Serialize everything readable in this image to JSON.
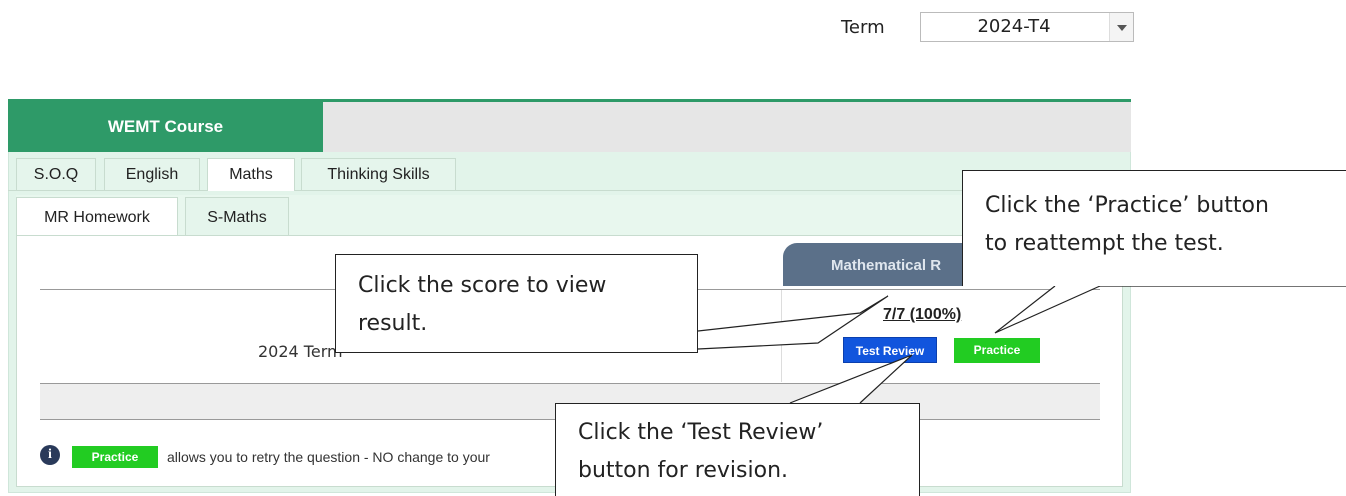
{
  "term": {
    "label": "Term",
    "value": "2024-T4"
  },
  "course": {
    "title": "WEMT Course"
  },
  "subject_tabs": [
    {
      "label": "S.O.Q"
    },
    {
      "label": "English"
    },
    {
      "label": "Maths"
    },
    {
      "label": "Thinking Skills"
    }
  ],
  "sub_tabs": [
    {
      "label": "MR Homework"
    },
    {
      "label": "S-Maths"
    }
  ],
  "table": {
    "header": "Mathematical R",
    "row_label": "2024 Term",
    "score": "7/7 (100%)",
    "review_button": "Test Review",
    "practice_button": "Practice"
  },
  "legend": {
    "practice_label": "Practice",
    "text": "allows you to retry the question - NO change to your"
  },
  "callouts": {
    "score": [
      "Click the score to view",
      "result."
    ],
    "practice": [
      "Click the ‘Practice’ button",
      "to reattempt the test."
    ],
    "review": [
      "Click the ‘Test Review’",
      "button for revision."
    ]
  }
}
